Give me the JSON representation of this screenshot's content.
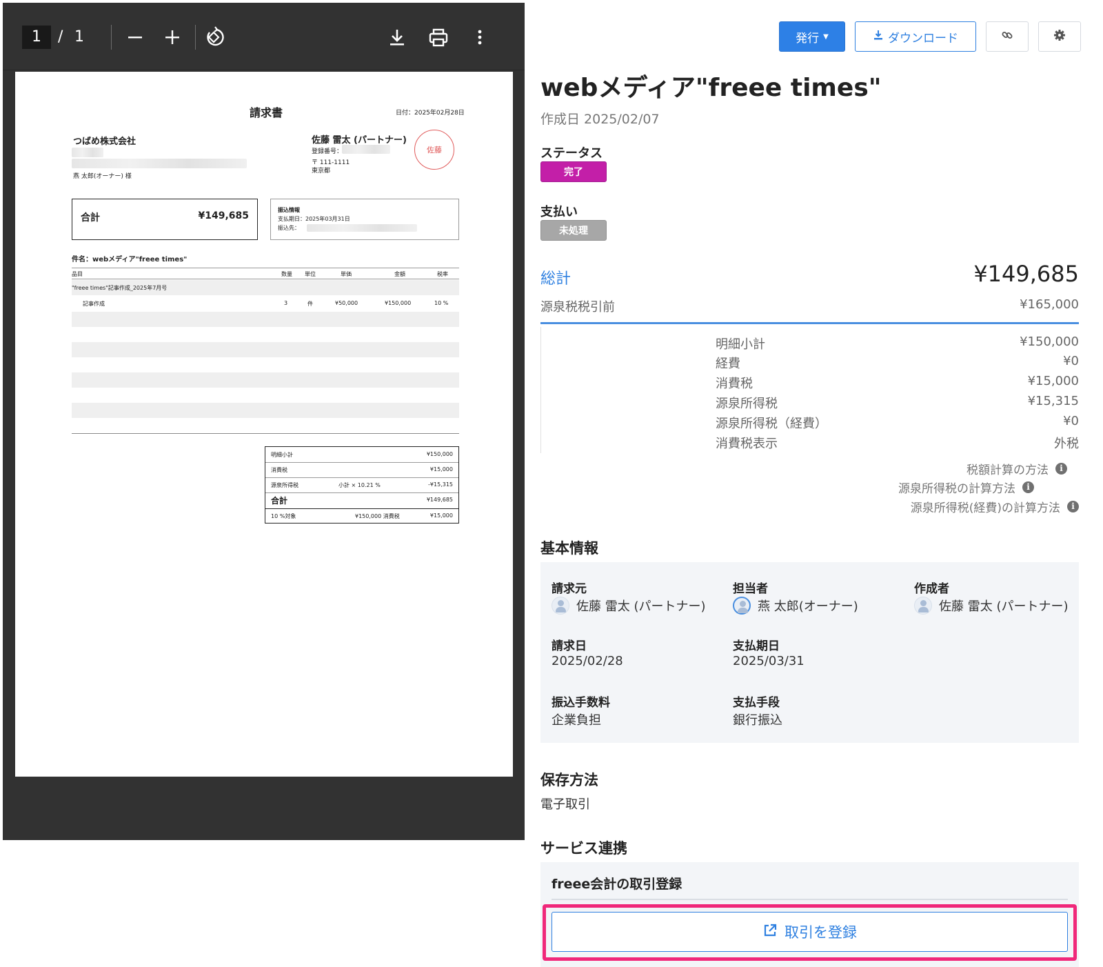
{
  "viewer": {
    "page_current": "1",
    "page_separator": "/",
    "page_total": "1"
  },
  "pdf": {
    "doc_title": "請求書",
    "date": "日付：2025年02月28日",
    "client_company": "つばめ株式会社",
    "client_contact": "燕 太郎(オーナー) 様",
    "issuer_name": "佐藤 雷太 (パートナー)",
    "issuer_reg_label": "登録番号：",
    "issuer_postal": "〒 111-1111",
    "issuer_pref": "東京都",
    "stamp": "佐藤",
    "total_label": "合計",
    "total_value": "¥149,685",
    "transfer_title": "振込情報",
    "transfer_due": "支払期日：2025年03月31日",
    "transfer_dest_label": "振込先：",
    "subject": "件名：webメディア\"freee times\"",
    "columns": [
      "品目",
      "数量",
      "単位",
      "単価",
      "金額",
      "税率"
    ],
    "group_row": "\"freee times\"記事作成_2025年7月号",
    "line_item": {
      "name": "記事作成",
      "qty": "3",
      "unit": "件",
      "price": "¥50,000",
      "amount": "¥150,000",
      "tax": "10 %"
    },
    "summary": {
      "subtotal_label": "明細小計",
      "subtotal_value": "¥150,000",
      "tax_label": "消費税",
      "tax_value": "¥15,000",
      "withholding_label": "源泉所得税",
      "withholding_note": "小計 × 10.21 %",
      "withholding_value": "-¥15,315",
      "total_label": "合計",
      "total_value": "¥149,685",
      "breakdown_label": "10 %対象",
      "breakdown_mid": "¥150,000 消費税",
      "breakdown_value": "¥15,000"
    }
  },
  "header_buttons": {
    "issue": "発行",
    "download": "ダウンロード"
  },
  "detail": {
    "title": "webメディア\"freee times\"",
    "created": "作成日 2025/02/07",
    "status_label": "ステータス",
    "status_badge": "完了",
    "payment_label": "支払い",
    "payment_badge": "未処理",
    "total_label": "総計",
    "total_value": "¥149,685",
    "pretax_label": "源泉税税引前",
    "pretax_value": "¥165,000",
    "breakdown": [
      {
        "label": "明細小計",
        "value": "¥150,000"
      },
      {
        "label": "経費",
        "value": "¥0"
      },
      {
        "label": "消費税",
        "value": "¥15,000"
      },
      {
        "label": "源泉所得税",
        "value": "¥15,315"
      },
      {
        "label": "源泉所得税（経費）",
        "value": "¥0"
      },
      {
        "label": "消費税表示",
        "value": "外税"
      }
    ],
    "help_links": [
      "税額計算の方法",
      "源泉所得税の計算方法",
      "源泉所得税(経費)の計算方法"
    ],
    "basic": {
      "title": "基本情報",
      "issuer_label": "請求元",
      "issuer_value": "佐藤 雷太 (パートナー)",
      "assignee_label": "担当者",
      "assignee_value": "燕 太郎(オーナー)",
      "creator_label": "作成者",
      "creator_value": "佐藤 雷太 (パートナー)",
      "invoice_date_label": "請求日",
      "invoice_date_value": "2025/02/28",
      "due_label": "支払期日",
      "due_value": "2025/03/31",
      "fee_label": "振込手数料",
      "fee_value": "企業負担",
      "method_label": "支払手段",
      "method_value": "銀行振込"
    },
    "storage_title": "保存方法",
    "storage_value": "電子取引",
    "service_title": "サービス連携",
    "service_box_title": "freee会計の取引登録",
    "register_button": "取引を登録"
  },
  "colors": {
    "accent": "#2d80e6",
    "status_complete": "#c31fa8",
    "status_pending": "#a7a7a7",
    "highlight": "#f0287a",
    "viewer_bg": "#323232"
  },
  "icons": [
    "minus-icon",
    "plus-icon",
    "rotate-icon",
    "download-icon",
    "print-icon",
    "more-vert-icon",
    "link-icon",
    "gear-icon",
    "external-link-icon",
    "info-icon",
    "avatar"
  ]
}
